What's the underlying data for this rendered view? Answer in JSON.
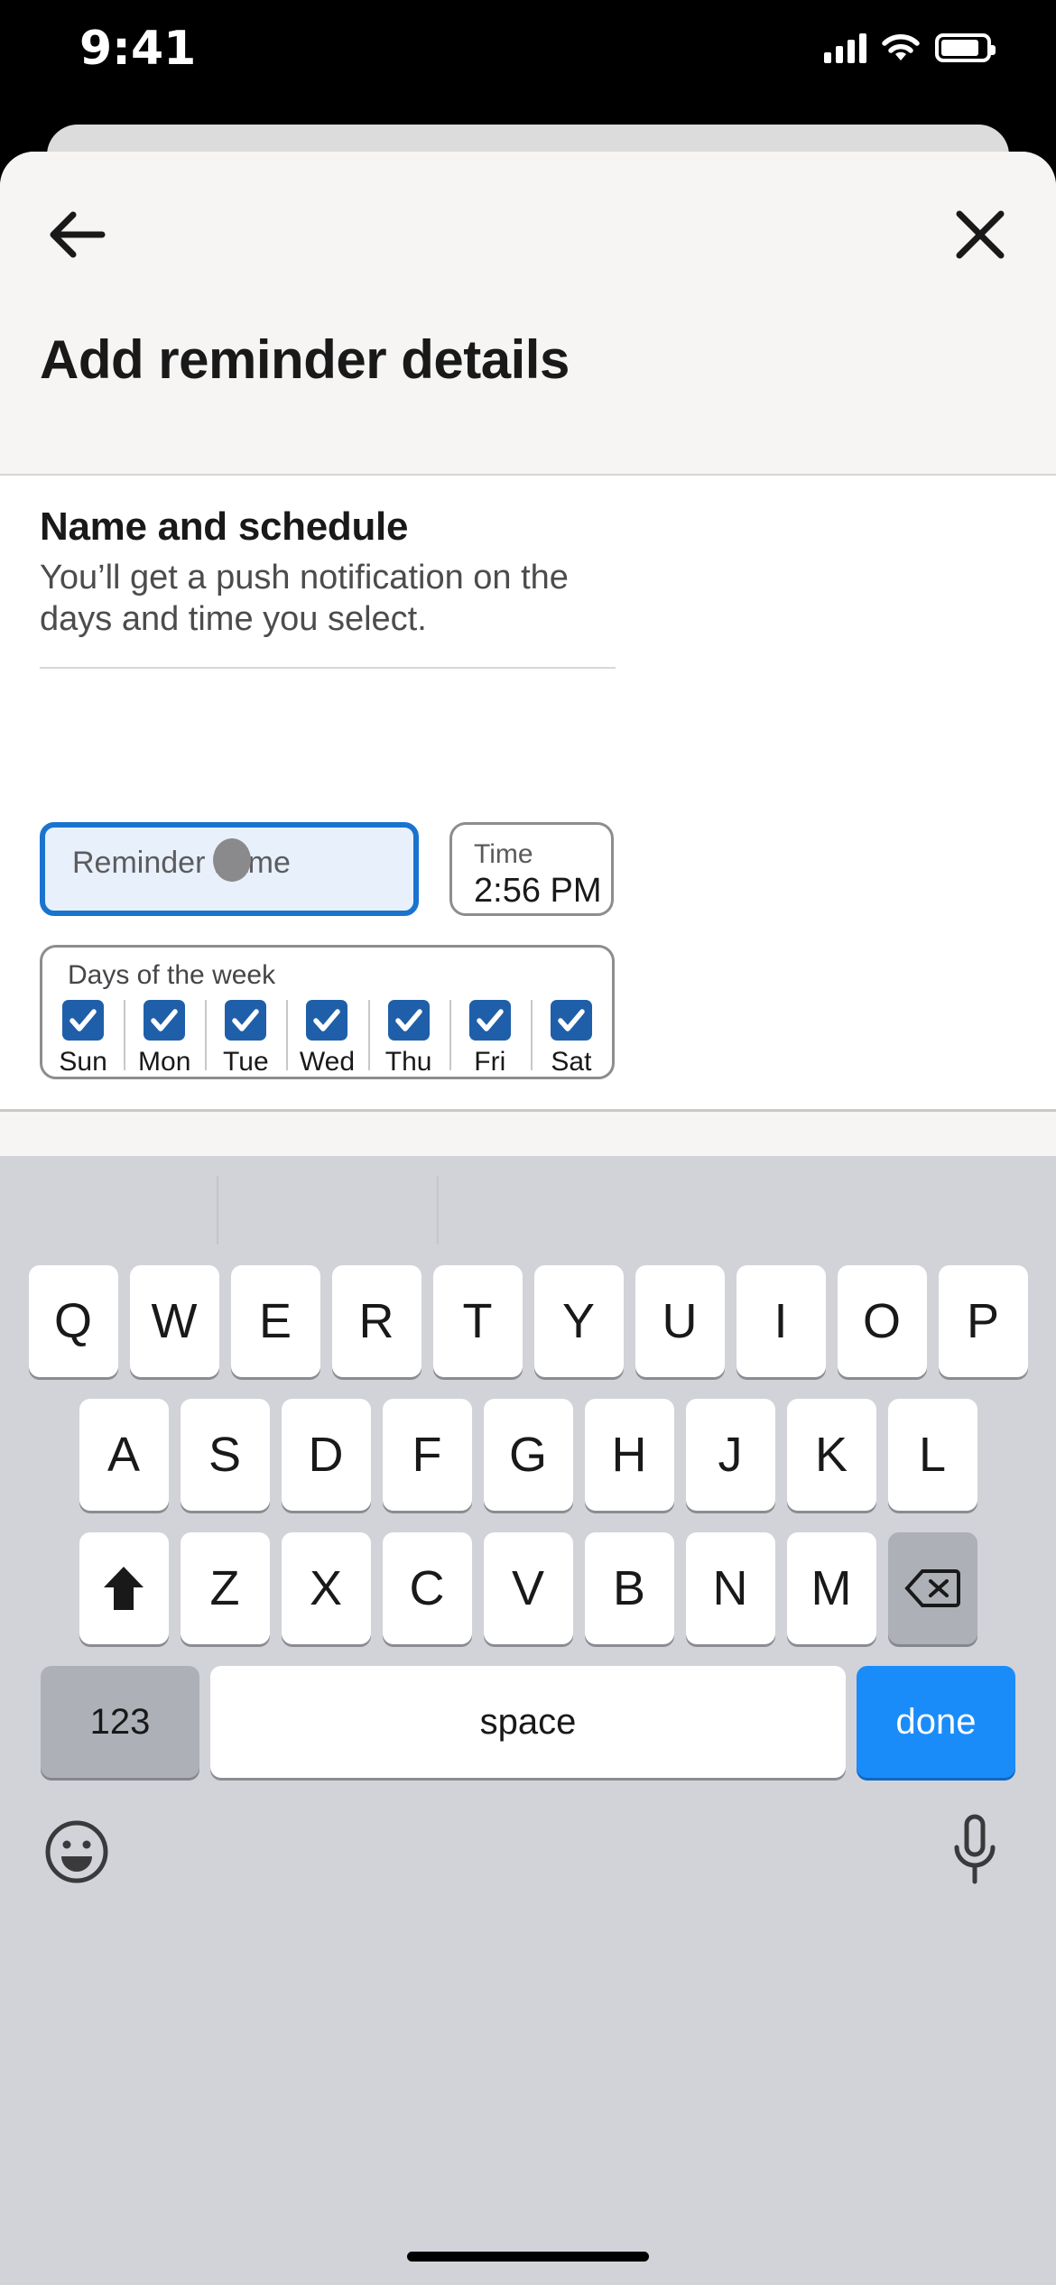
{
  "status_bar": {
    "time": "9:41",
    "signal_icon": "cellular-signal-icon",
    "wifi_icon": "wifi-icon",
    "battery_icon": "battery-icon"
  },
  "sheet": {
    "back_icon": "back-arrow-icon",
    "close_icon": "close-x-icon",
    "title": "Add reminder details"
  },
  "form": {
    "section_title": "Name and schedule",
    "section_desc": "You’ll get a push notification on the days and time you select.",
    "name_input": {
      "placeholder": "Reminder name",
      "value": "",
      "focused": true,
      "border_color": "#1a73cf",
      "fill_color": "#e8f1fb"
    },
    "time_field": {
      "label": "Time",
      "value": "2:56 PM"
    },
    "days_field": {
      "label": "Days of the week",
      "accent_color": "#1f5fa9",
      "days": [
        {
          "label": "Sun",
          "checked": true
        },
        {
          "label": "Mon",
          "checked": true
        },
        {
          "label": "Tue",
          "checked": true
        },
        {
          "label": "Wed",
          "checked": true
        },
        {
          "label": "Thu",
          "checked": true
        },
        {
          "label": "Fri",
          "checked": true
        },
        {
          "label": "Sat",
          "checked": true
        }
      ]
    }
  },
  "keyboard": {
    "row1": [
      "Q",
      "W",
      "E",
      "R",
      "T",
      "Y",
      "U",
      "I",
      "O",
      "P"
    ],
    "row2": [
      "A",
      "S",
      "D",
      "F",
      "G",
      "H",
      "J",
      "K",
      "L"
    ],
    "row3": [
      "Z",
      "X",
      "C",
      "V",
      "B",
      "N",
      "M"
    ],
    "shift_icon": "shift-arrow-icon",
    "delete_icon": "backspace-icon",
    "numeric_label": "123",
    "space_label": "space",
    "done_label": "done",
    "done_color": "#1a8cfa",
    "emoji_icon": "emoji-smiley-icon",
    "mic_icon": "microphone-icon"
  }
}
